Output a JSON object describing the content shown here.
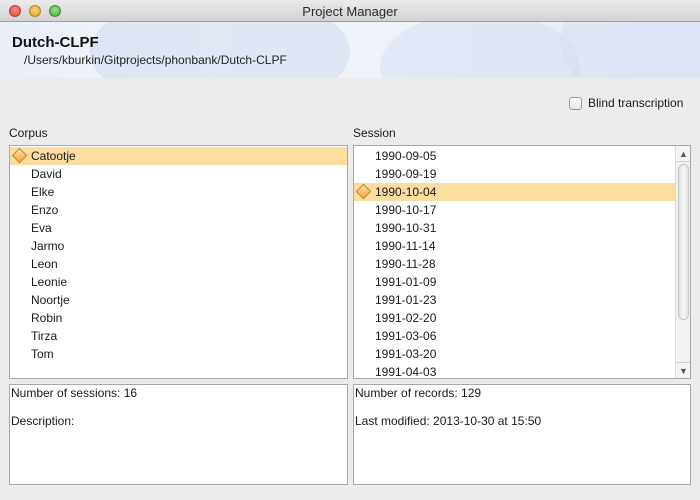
{
  "window": {
    "title": "Project Manager"
  },
  "project": {
    "name": "Dutch-CLPF",
    "path": "/Users/kburkin/Gitprojects/phonbank/Dutch-CLPF"
  },
  "options": {
    "blind_transcription_label": "Blind transcription",
    "blind_transcription_checked": false
  },
  "corpus": {
    "label": "Corpus",
    "items": [
      "Catootje",
      "David",
      "Elke",
      "Enzo",
      "Eva",
      "Jarmo",
      "Leon",
      "Leonie",
      "Noortje",
      "Robin",
      "Tirza",
      "Tom"
    ],
    "selected": "Catootje",
    "info": {
      "sessions": "Number of sessions: 16",
      "description": "Description:"
    }
  },
  "session": {
    "label": "Session",
    "items": [
      "1990-09-05",
      "1990-09-19",
      "1990-10-04",
      "1990-10-17",
      "1990-10-31",
      "1990-11-14",
      "1990-11-28",
      "1991-01-09",
      "1991-01-23",
      "1991-02-20",
      "1991-03-06",
      "1991-03-20",
      "1991-04-03"
    ],
    "selected": "1990-10-04",
    "info": {
      "records": "Number of records: 129",
      "modified": "Last modified: 2013-10-30 at 15:50"
    }
  },
  "icons": {
    "close": "close-button",
    "minimize": "minimize-button",
    "maximize": "zoom-button",
    "selection": "session-diamond-icon",
    "scroll_up": "scroll-up-arrow-icon",
    "scroll_down": "scroll-down-arrow-icon"
  },
  "colors": {
    "selection_bg": "#fbdda0",
    "selection_icon": "#f4a63e"
  }
}
